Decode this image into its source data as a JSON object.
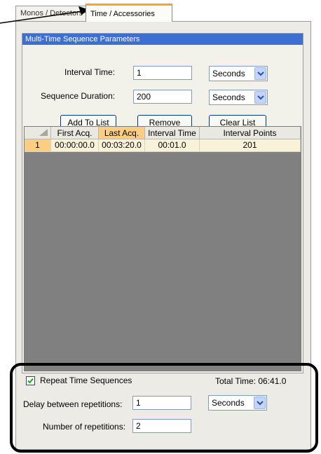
{
  "tabs": [
    {
      "label": "Monos / Detectors",
      "active": false
    },
    {
      "label": "Time / Accessories",
      "active": true
    }
  ],
  "sequence_group": {
    "title": "Multi-Time Sequence Parameters",
    "interval_time": {
      "label": "Interval Time:",
      "value": "1",
      "unit": "Seconds"
    },
    "sequence_duration": {
      "label": "Sequence Duration:",
      "value": "200",
      "unit": "Seconds"
    },
    "buttons": {
      "add": "Add To List",
      "remove": "Remove",
      "clear": "Clear List"
    },
    "table": {
      "columns": [
        "",
        "First Acq.",
        "Last Acq.",
        "Interval Time",
        "Interval Points"
      ],
      "selected_column": "Last Acq.",
      "rows": [
        {
          "index": "1",
          "first_acq": "00:00:00.0",
          "last_acq": "00:03:20.0",
          "interval_time": "00:01.0",
          "interval_points": "201"
        }
      ]
    }
  },
  "repeat": {
    "checkbox_label": "Repeat Time Sequences",
    "checked": true,
    "total_time": "Total Time: 06:41.0",
    "delay": {
      "label": "Delay between repetitions:",
      "value": "1",
      "unit": "Seconds"
    },
    "count": {
      "label": "Number of repetitions:",
      "value": "2"
    }
  },
  "colors": {
    "group_title_bg": "#3d6ed2",
    "active_tab_accent": "#f5a623",
    "selected_header_bg": "#fbce82",
    "grid_empty_bg": "#808080",
    "highlight_frame": "#000000"
  }
}
